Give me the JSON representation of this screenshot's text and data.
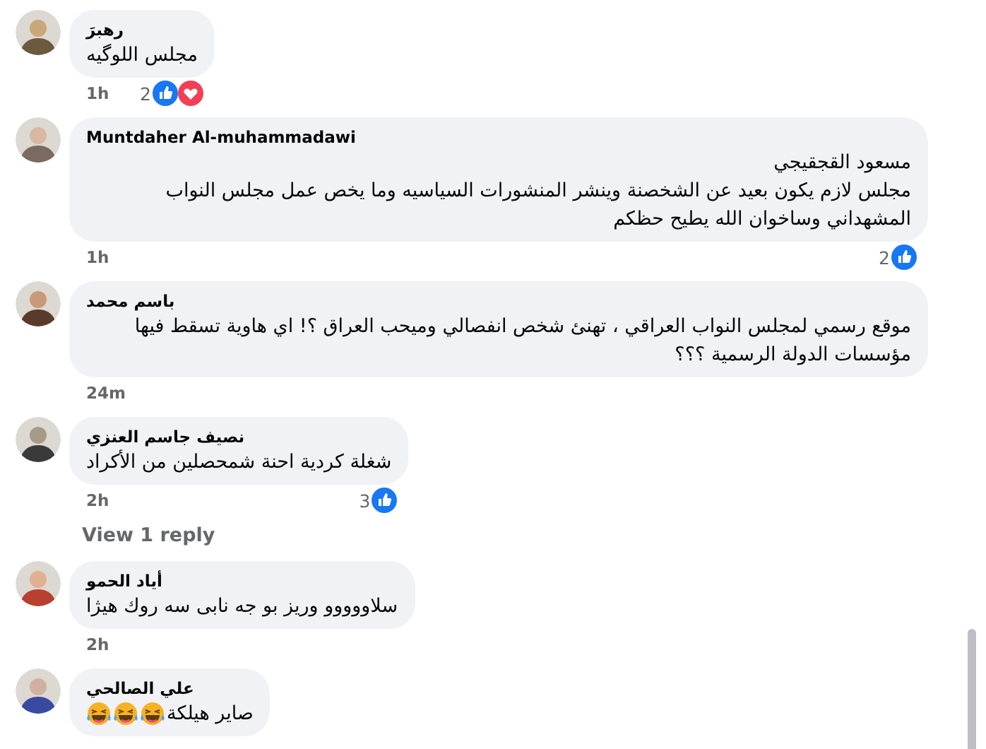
{
  "comments": [
    {
      "author": "رهبرَ",
      "body": [
        "مجلس اللوگيه"
      ],
      "time": "1h",
      "reaction_count": "2",
      "reactions": [
        {
          "kind": "like"
        },
        {
          "kind": "love"
        }
      ]
    },
    {
      "author": "Muntdaher Al-muhammadawi",
      "body": [
        "مسعود القجقيجي",
        "مجلس لازم يكون بعيد عن الشخصنة وينشر المنشورات السياسيه وما يخص عمل مجلس النواب المشهداني وساخوان الله يطيح حظكم"
      ],
      "time": "1h",
      "reaction_count": "2",
      "reactions": [
        {
          "kind": "like"
        }
      ]
    },
    {
      "author": "باسم محمد",
      "body": [
        "موقع رسمي لمجلس النواب العراقي ، تهنئ شخص انفصالي وميحب العراق ؟! اي هاوية تسقط فيها مؤسسات الدولة الرسمية ؟؟؟"
      ],
      "time": "24m"
    },
    {
      "author": "نصيف جاسم العنزي",
      "body": [
        "شغلة كردية احنة شمحصلين من الأكراد"
      ],
      "time": "2h",
      "reaction_count": "3",
      "reactions": [
        {
          "kind": "like"
        }
      ],
      "replies_link": "View 1 reply"
    },
    {
      "author": "أياد الحمو",
      "body": [
        "سلاووووو وريز بو جه نابى سه روك هيژا"
      ],
      "time": "2h"
    },
    {
      "author": "علي الصالحي",
      "body": [
        "صاير هيلكة"
      ],
      "emojis": [
        {
          "kind": "haha"
        },
        {
          "kind": "haha"
        },
        {
          "kind": "haha"
        }
      ]
    }
  ]
}
